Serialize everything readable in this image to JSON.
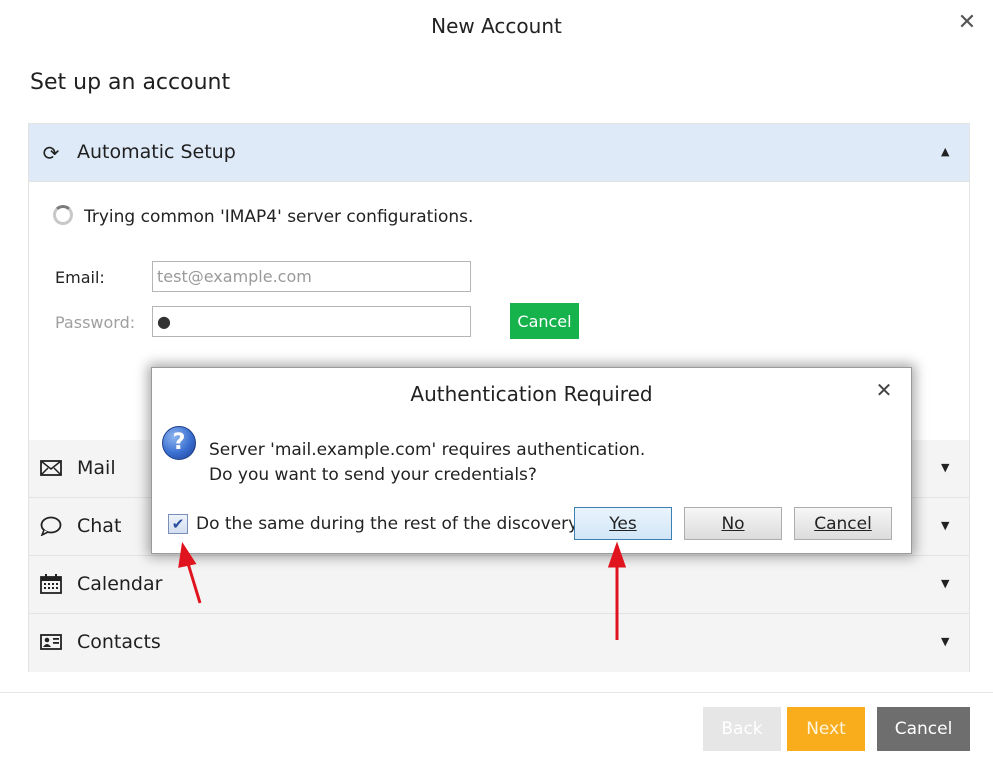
{
  "window": {
    "title": "New Account",
    "close_glyph": "✕"
  },
  "page": {
    "heading": "Set up an account"
  },
  "accordion": {
    "automatic": {
      "icon": "refresh-icon",
      "label": "Automatic Setup",
      "status": "Trying common 'IMAP4' server configurations.",
      "email_label": "Email:",
      "email_placeholder": "test@example.com",
      "password_label": "Password:",
      "password_value": "●",
      "cancel_label": "Cancel"
    },
    "items": [
      {
        "icon": "mail-icon",
        "label": "Mail"
      },
      {
        "icon": "chat-icon",
        "label": "Chat"
      },
      {
        "icon": "calendar-icon",
        "label": "Calendar"
      },
      {
        "icon": "contacts-icon",
        "label": "Contacts"
      }
    ]
  },
  "dialog": {
    "title": "Authentication Required",
    "close_glyph": "✕",
    "message_line1": "Server 'mail.example.com' requires authentication.",
    "message_line2": "Do you want to send your credentials?",
    "checkbox_label": "Do the same during the rest of the discovery.",
    "checkbox_checked": true,
    "yes_label": "Yes",
    "no_label": "No",
    "cancel_label": "Cancel"
  },
  "footer": {
    "back_label": "Back",
    "next_label": "Next",
    "cancel_label": "Cancel"
  },
  "colors": {
    "active_header": "#dfeaf8",
    "green_button": "#16b24c",
    "next_button": "#f9ad1d",
    "back_button": "#e6e6e6",
    "cancel_button": "#6e6e6e",
    "annotation_arrow": "#e0141e"
  }
}
